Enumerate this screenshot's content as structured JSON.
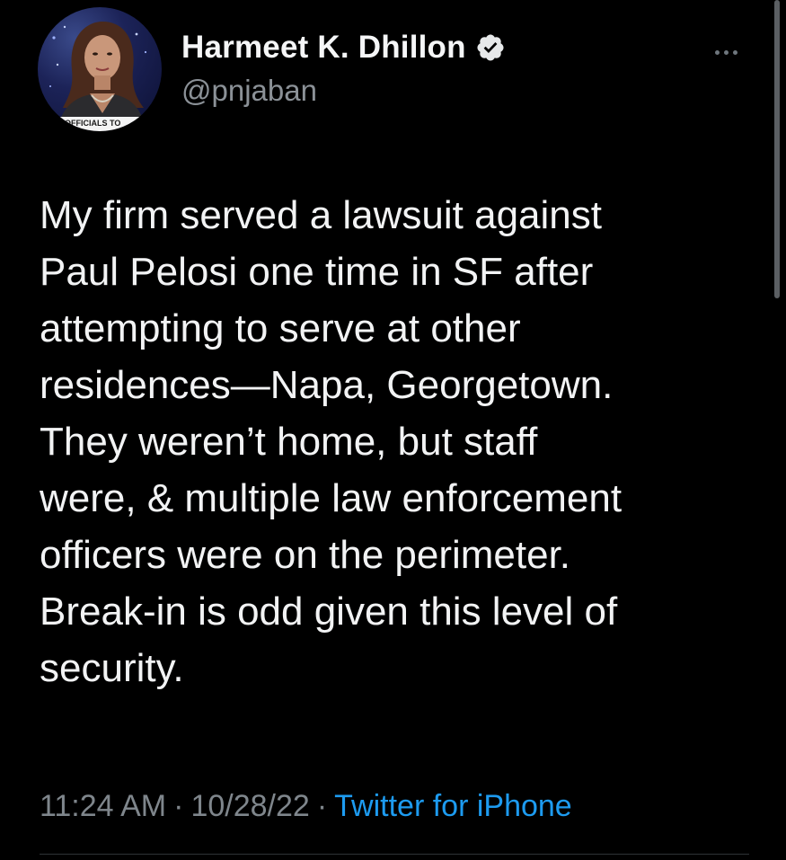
{
  "author": {
    "name": "Harmeet K. Dhillon",
    "handle": "@pnjaban",
    "verified": true,
    "avatar_caption": "OFFICIALS TO"
  },
  "tweet": {
    "lines": [
      "My firm served a lawsuit against",
      "Paul Pelosi one time in SF after",
      "attempting to serve at other",
      "residences—Napa, Georgetown.",
      "They weren’t home, but staff",
      "were, & multiple law enforcement",
      "officers were on the perimeter.",
      "Break-in is odd given this level of",
      "security."
    ],
    "time": "11:24 AM",
    "date": "10/28/22",
    "separator": "·",
    "source": "Twitter for iPhone"
  },
  "icons": {
    "verified": "verified-badge-icon",
    "more": "more-options-icon"
  },
  "colors": {
    "background": "#000000",
    "link": "#1d9bf0",
    "secondary_text": "#7f868c"
  }
}
